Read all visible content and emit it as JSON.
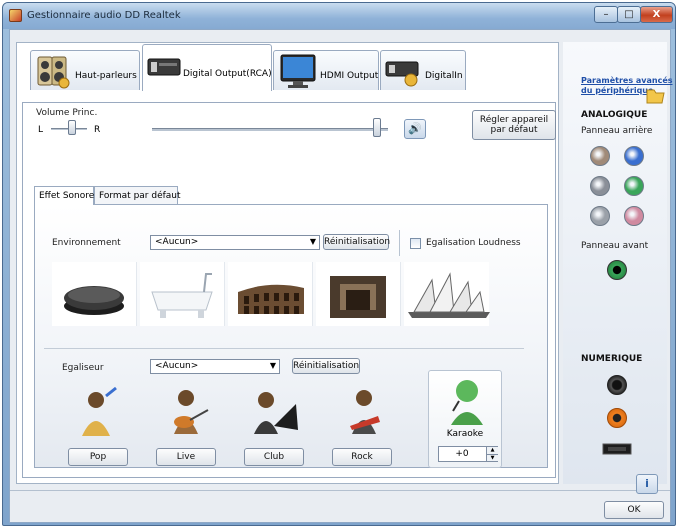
{
  "window": {
    "title": "Gestionnaire audio DD Realtek",
    "minimize": "–",
    "maximize": "□",
    "close": "X"
  },
  "tabs": [
    {
      "label": "Haut-parleurs",
      "active": false
    },
    {
      "label": "Digital Output(RCA)",
      "active": true
    },
    {
      "label": "HDMI Output",
      "active": false
    },
    {
      "label": "DigitalIn",
      "active": false
    }
  ],
  "volume": {
    "label": "Volume Princ.",
    "left_label": "L",
    "right_label": "R",
    "level": 0.97,
    "balance": 0.5
  },
  "default_button": "Régler appareil par défaut",
  "subtabs": [
    {
      "label": "Effet Sonore",
      "active": true
    },
    {
      "label": "Format par défaut",
      "active": false
    }
  ],
  "environment": {
    "label": "Environnement",
    "selected": "<Aucun>",
    "reset_label": "Réinitialisation",
    "loudness_label": "Egalisation Loudness",
    "loudness_checked": false
  },
  "equalizer": {
    "label": "Egaliseur",
    "selected": "<Aucun>",
    "reset_label": "Réinitialisation",
    "presets": [
      "Pop",
      "Live",
      "Club",
      "Rock"
    ]
  },
  "karaoke": {
    "label": "Karaoke",
    "value": "+0"
  },
  "side": {
    "advanced_link": "Paramètres avancés du périphérique",
    "analog_title": "ANALOGIQUE",
    "rear_panel": "Panneau arrière",
    "front_panel": "Panneau avant",
    "digital_title": "NUMERIQUE",
    "rear_jack_colors": [
      "#a08a78",
      "#3a6fd0",
      "#8a8f98",
      "#3aa55a",
      "#9aa0a8",
      "#d08aa0"
    ]
  },
  "ok_label": "OK"
}
